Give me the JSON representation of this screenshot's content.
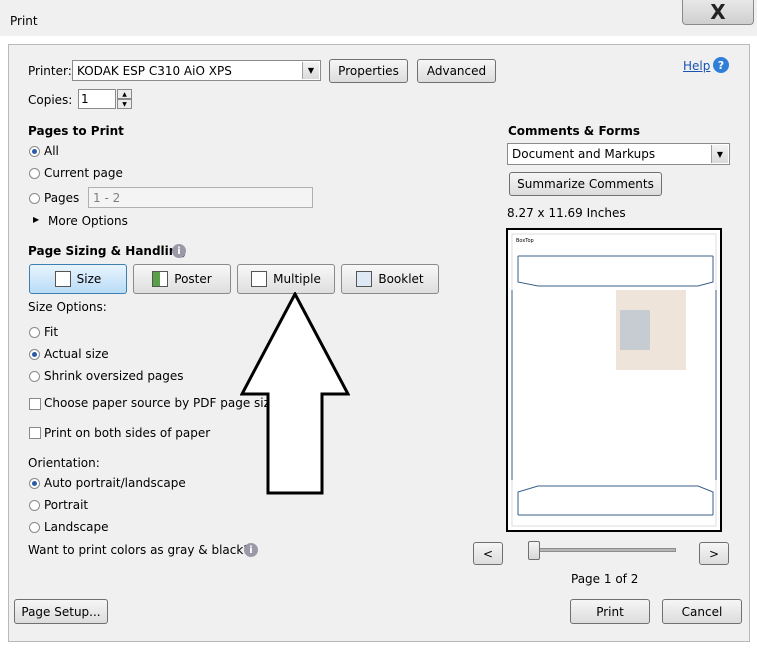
{
  "window": {
    "title": "Print",
    "close_label": "X"
  },
  "printer": {
    "label": "Printer:",
    "value": "KODAK ESP C310 AiO XPS",
    "properties_label": "Properties",
    "advanced_label": "Advanced"
  },
  "help": {
    "label": "Help"
  },
  "copies": {
    "label": "Copies:",
    "value": "1"
  },
  "pages_to_print": {
    "heading": "Pages to Print",
    "all": "All",
    "current": "Current page",
    "pages": "Pages",
    "pages_value": "1 - 2",
    "more_options": "More Options"
  },
  "sizing": {
    "heading": "Page Sizing & Handling",
    "size": "Size",
    "poster": "Poster",
    "multiple": "Multiple",
    "booklet": "Booklet",
    "size_options_label": "Size Options:",
    "fit": "Fit",
    "actual": "Actual size",
    "shrink": "Shrink oversized pages",
    "paper_source": "Choose paper source by PDF page size",
    "both_sides": "Print on both sides of paper"
  },
  "orientation": {
    "label": "Orientation:",
    "auto": "Auto portrait/landscape",
    "portrait": "Portrait",
    "landscape": "Landscape"
  },
  "gray_question": "Want to print colors as gray & black?",
  "comments": {
    "heading": "Comments & Forms",
    "value": "Document and Markups",
    "summarize_label": "Summarize Comments"
  },
  "preview": {
    "size_text": "8.27 x 11.69 Inches",
    "page_text": "Page 1 of 2",
    "prev_label": "<",
    "next_label": ">",
    "slider_fraction": 0.0
  },
  "footer": {
    "page_setup_label": "Page Setup...",
    "print_label": "Print",
    "cancel_label": "Cancel"
  }
}
